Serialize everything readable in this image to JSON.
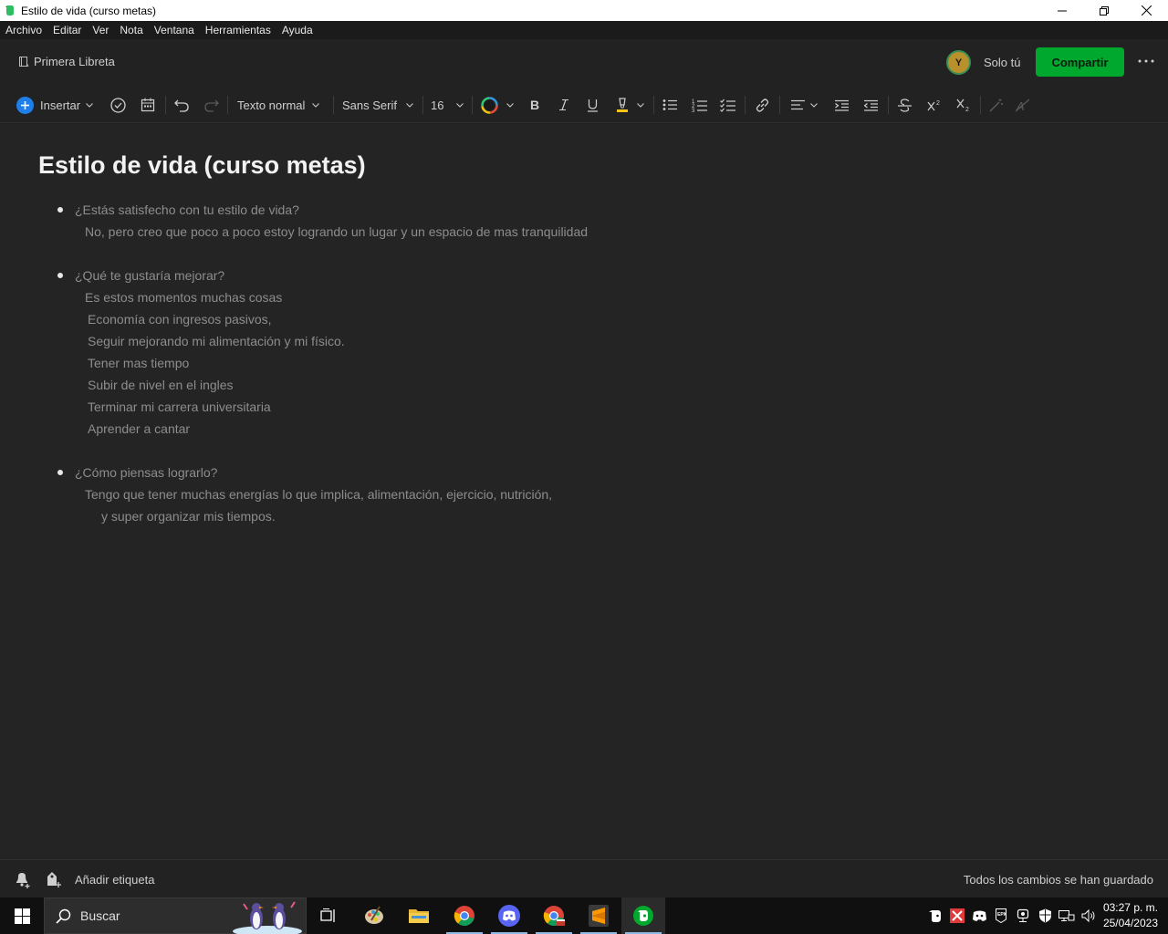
{
  "window": {
    "title": "Estilo de vida (curso metas)",
    "controls": [
      "minimize-icon",
      "restore-icon",
      "close-icon"
    ]
  },
  "menu": [
    "Archivo",
    "Editar",
    "Ver",
    "Nota",
    "Ventana",
    "Herramientas",
    "Ayuda"
  ],
  "header": {
    "notebook": "Primera Libreta",
    "avatar_initial": "Y",
    "sharing_status": "Solo tú",
    "share_label": "Compartir"
  },
  "toolbar": {
    "insert_label": "Insertar",
    "text_style": "Texto normal",
    "font": "Sans Serif",
    "font_size": "16"
  },
  "note": {
    "title": "Estilo de vida (curso metas)",
    "questions": [
      "¿Estás satisfecho con tu estilo de vida?",
      "¿Qué te gustaría mejorar?",
      "¿Cómo piensas lograrlo?"
    ],
    "answers": [
      "No, pero creo que poco a poco estoy logrando un lugar y un espacio de mas tranquilidad",
      "Es estos momentos muchas cosas",
      "Economía con ingresos pasivos,",
      "Seguir mejorando mi alimentación y mi físico.",
      "Tener mas tiempo",
      "Subir de nivel en el ingles",
      "Terminar mi carrera universitaria",
      "Aprender a cantar",
      "Tengo que tener muchas energías lo que implica, alimentación, ejercicio, nutrición,",
      "y super organizar mis tiempos."
    ]
  },
  "footer": {
    "add_tag": "Añadir etiqueta",
    "save_status": "Todos los cambios se han guardado"
  },
  "taskbar": {
    "search": "Buscar",
    "time": "03:27 p. m.",
    "date": "25/04/2023"
  },
  "colors": {
    "accent_green": "#00a82d",
    "background": "#242424",
    "text_muted": "#8d8d8d"
  }
}
